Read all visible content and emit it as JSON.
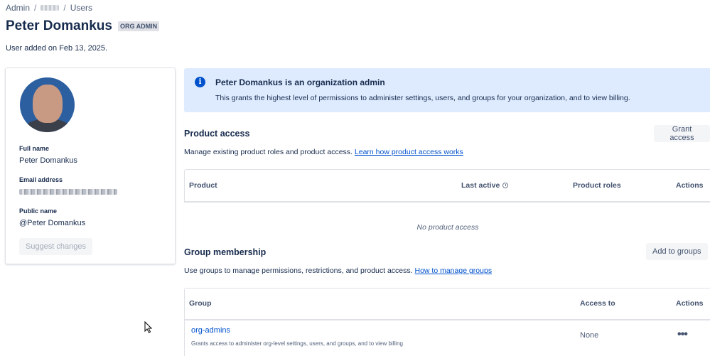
{
  "breadcrumb": {
    "admin": "Admin",
    "sep1": "/",
    "sep2": "/",
    "users": "Users"
  },
  "user": {
    "name": "Peter Domankus",
    "role_badge": "ORG ADMIN",
    "added": "User added on Feb 13, 2025."
  },
  "profile": {
    "full_name_label": "Full name",
    "full_name": "Peter Domankus",
    "email_label": "Email address",
    "public_name_label": "Public name",
    "public_name": "@Peter Domankus",
    "suggest_button": "Suggest changes"
  },
  "banner": {
    "icon": "info-icon",
    "icon_glyph": "i",
    "title": "Peter Domankus is an organization admin",
    "text": "This grants the highest level of permissions to administer settings, users, and groups for your organization, and to view billing."
  },
  "product_access": {
    "title": "Product access",
    "grant_button": "Grant access",
    "desc": "Manage existing product roles and product access.",
    "link": "Learn how product access works",
    "columns": {
      "product": "Product",
      "last_active": "Last active",
      "product_roles": "Product roles",
      "actions": "Actions"
    },
    "empty": "No product access"
  },
  "groups": {
    "title": "Group membership",
    "add_button": "Add to groups",
    "desc": "Use groups to manage permissions, restrictions, and product access.",
    "link": "How to manage groups",
    "columns": {
      "group": "Group",
      "access_to": "Access to",
      "actions": "Actions"
    },
    "rows": [
      {
        "name": "org-admins",
        "description": "Grants access to administer org-level settings, users, and groups, and to view billing",
        "access": "None",
        "actions_icon": "more-icon",
        "actions_glyph": "•••"
      }
    ]
  },
  "colors": {
    "link": "#0052cc",
    "banner_bg": "#deebff",
    "text": "#172b4d"
  }
}
